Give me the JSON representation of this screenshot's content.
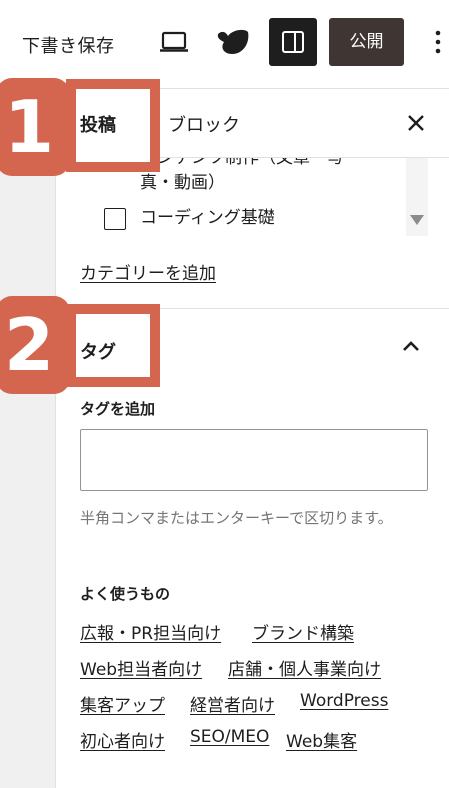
{
  "topbar": {
    "draft_label": "下書き保存",
    "publish_label": "公開"
  },
  "tabs": {
    "post_label": "投稿",
    "block_label": "ブロック"
  },
  "categories": {
    "items": [
      {
        "label": "コンテンツ制作（文章・写真・動画）",
        "checked": false
      },
      {
        "label": "コーディング基礎",
        "checked": false
      }
    ],
    "add_link": "カテゴリーを追加"
  },
  "tags": {
    "title": "タグ",
    "add_label": "タグを追加",
    "input_value": "",
    "help_text": "半角コンマまたはエンターキーで区切ります。",
    "frequent_title": "よく使うもの",
    "frequent": [
      "広報・PR担当向け",
      "ブランド構築",
      "Web担当者向け",
      "店舗・個人事業向け",
      "集客アップ",
      "経営者向け",
      "WordPress",
      "初心者向け",
      "SEO/MEO",
      "Web集客"
    ]
  },
  "badges": {
    "one": "1",
    "two": "2"
  },
  "colors": {
    "badge": "#d4654e",
    "publish_bg": "#3f3634",
    "toggle_bg": "#1e1e1e"
  },
  "icons": {
    "preview": "laptop-icon",
    "logo": "site-logo-icon",
    "sidebar": "sidebar-toggle-icon",
    "more": "vertical-ellipsis-icon",
    "close": "close-icon",
    "chevron": "chevron-up-icon",
    "scroll": "scroll-down-arrow-icon"
  }
}
